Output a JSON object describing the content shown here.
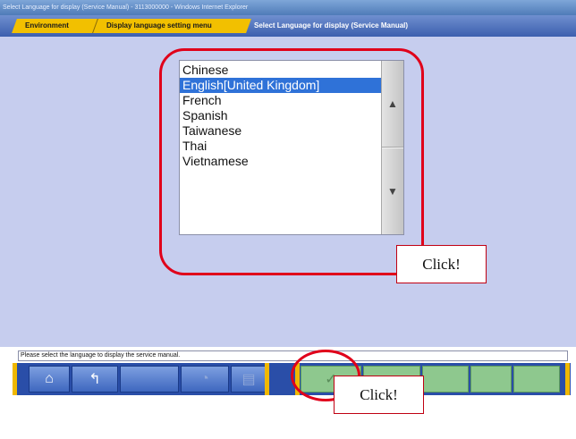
{
  "window": {
    "title": "Select Language for display (Service Manual) - 3113000000 - Windows Internet Explorer"
  },
  "breadcrumb": {
    "items": [
      "Environment",
      "Display language setting menu"
    ],
    "current": "Select Language for display (Service Manual)"
  },
  "language_list": {
    "items": [
      "Chinese",
      "English[United Kingdom]",
      "French",
      "Spanish",
      "Taiwanese",
      "Thai",
      "Vietnamese"
    ],
    "selected": "English[United Kingdom]"
  },
  "annotations": {
    "callout_list": "Click!",
    "callout_ok": "Click!",
    "oval_color": "#e0001a"
  },
  "status_message": "Please select the language to display the service manual.",
  "toolbar": {
    "buttons": [
      {
        "icon": "home-icon",
        "glyph": "⌂"
      },
      {
        "icon": "back-arrow-icon",
        "glyph": "↰"
      },
      {
        "icon": "empty-slot",
        "glyph": ""
      },
      {
        "icon": "globe-icon",
        "glyph": "◔"
      },
      {
        "icon": "document-icon",
        "glyph": "▤"
      }
    ],
    "ok_glyph": "✓"
  },
  "colors": {
    "content_background": "#c6cdee",
    "selection": "#2f72d8",
    "accent_yellow": "#f0b800",
    "toolbar_blue": "#2a4ea8",
    "confirm_green": "#8ec88e"
  }
}
